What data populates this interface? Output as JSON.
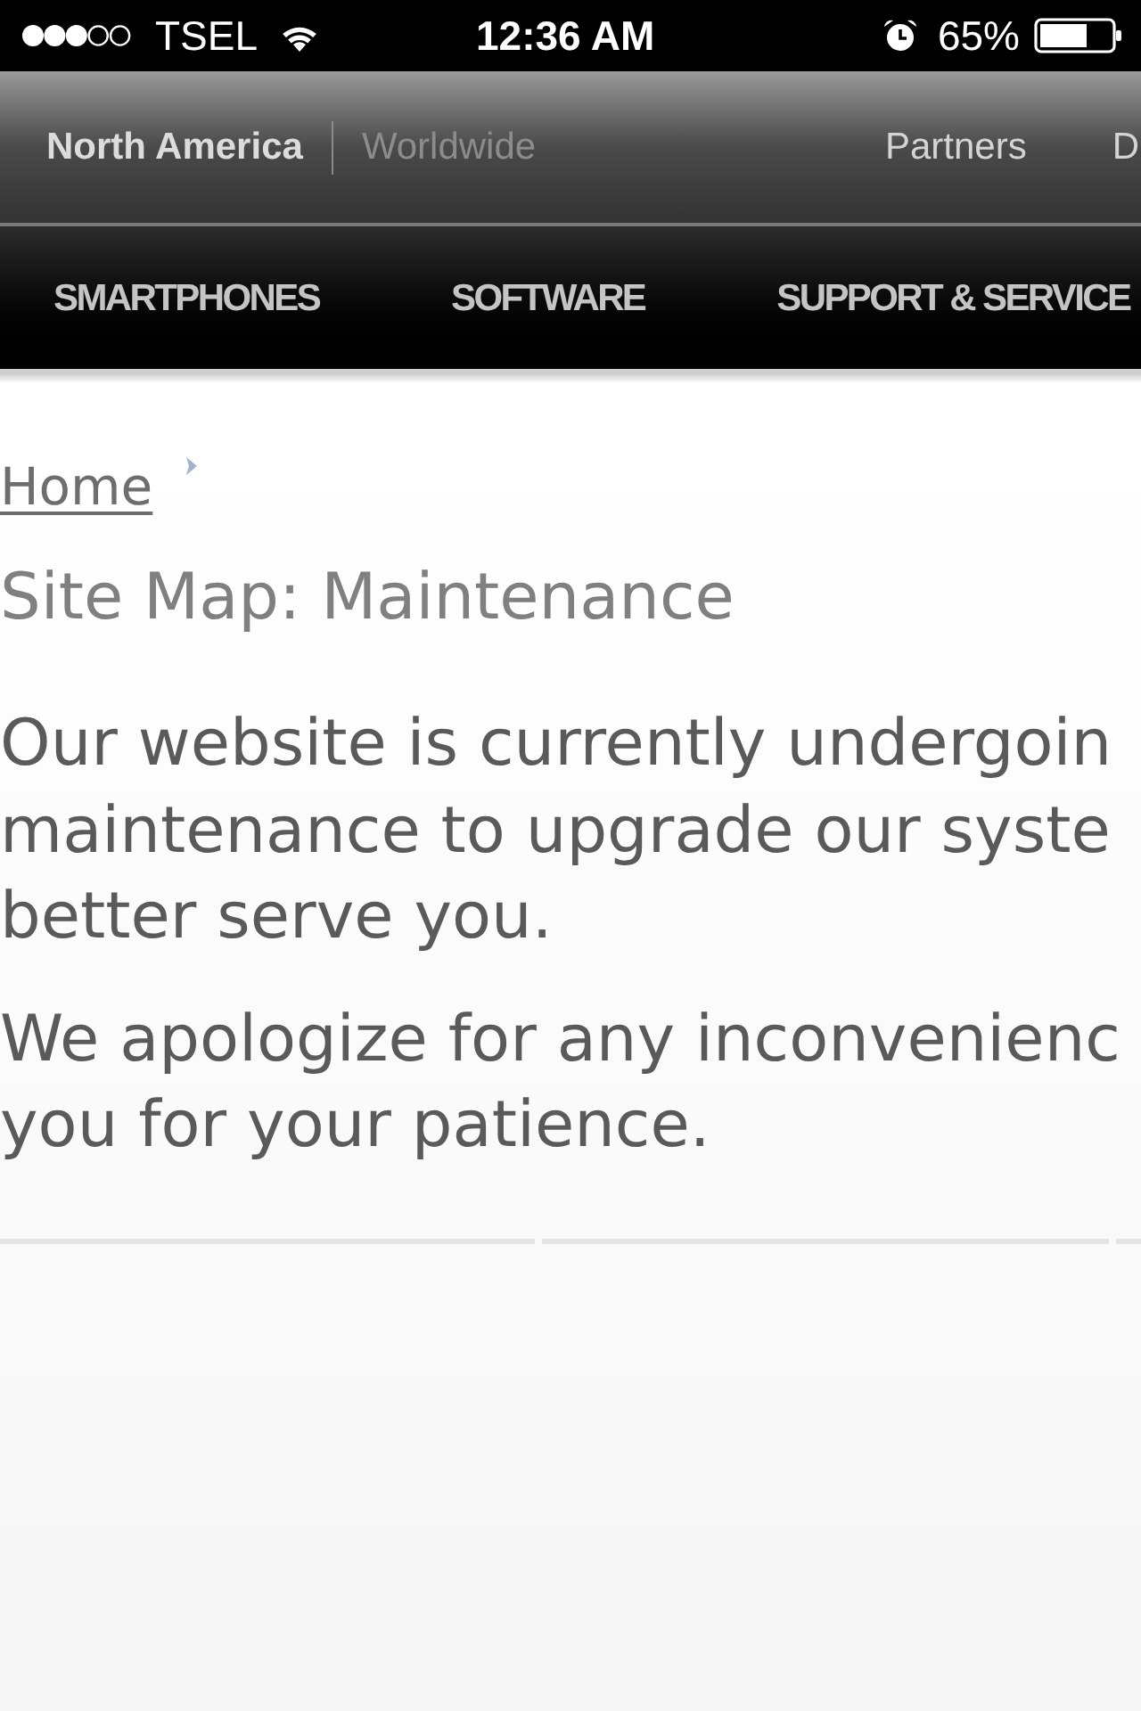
{
  "status_bar": {
    "carrier": "TSEL",
    "time": "12:36 AM",
    "battery": "65%"
  },
  "header": {
    "regions": [
      {
        "label": "North America",
        "selected": true
      },
      {
        "label": "Worldwide",
        "selected": false
      }
    ],
    "links": [
      "Partners",
      "D"
    ]
  },
  "main_nav": [
    "SMARTPHONES",
    "SOFTWARE",
    "SUPPORT & SERVICE"
  ],
  "breadcrumb": [
    "Home"
  ],
  "page_title": "Site Map: Maintenance",
  "paragraphs": [
    {
      "lines": [
        "Our website is currently undergoin",
        "maintenance to upgrade our syste",
        "better serve you."
      ]
    },
    {
      "lines": [
        "We apologize for any inconvenienc",
        "you for your patience."
      ]
    }
  ]
}
